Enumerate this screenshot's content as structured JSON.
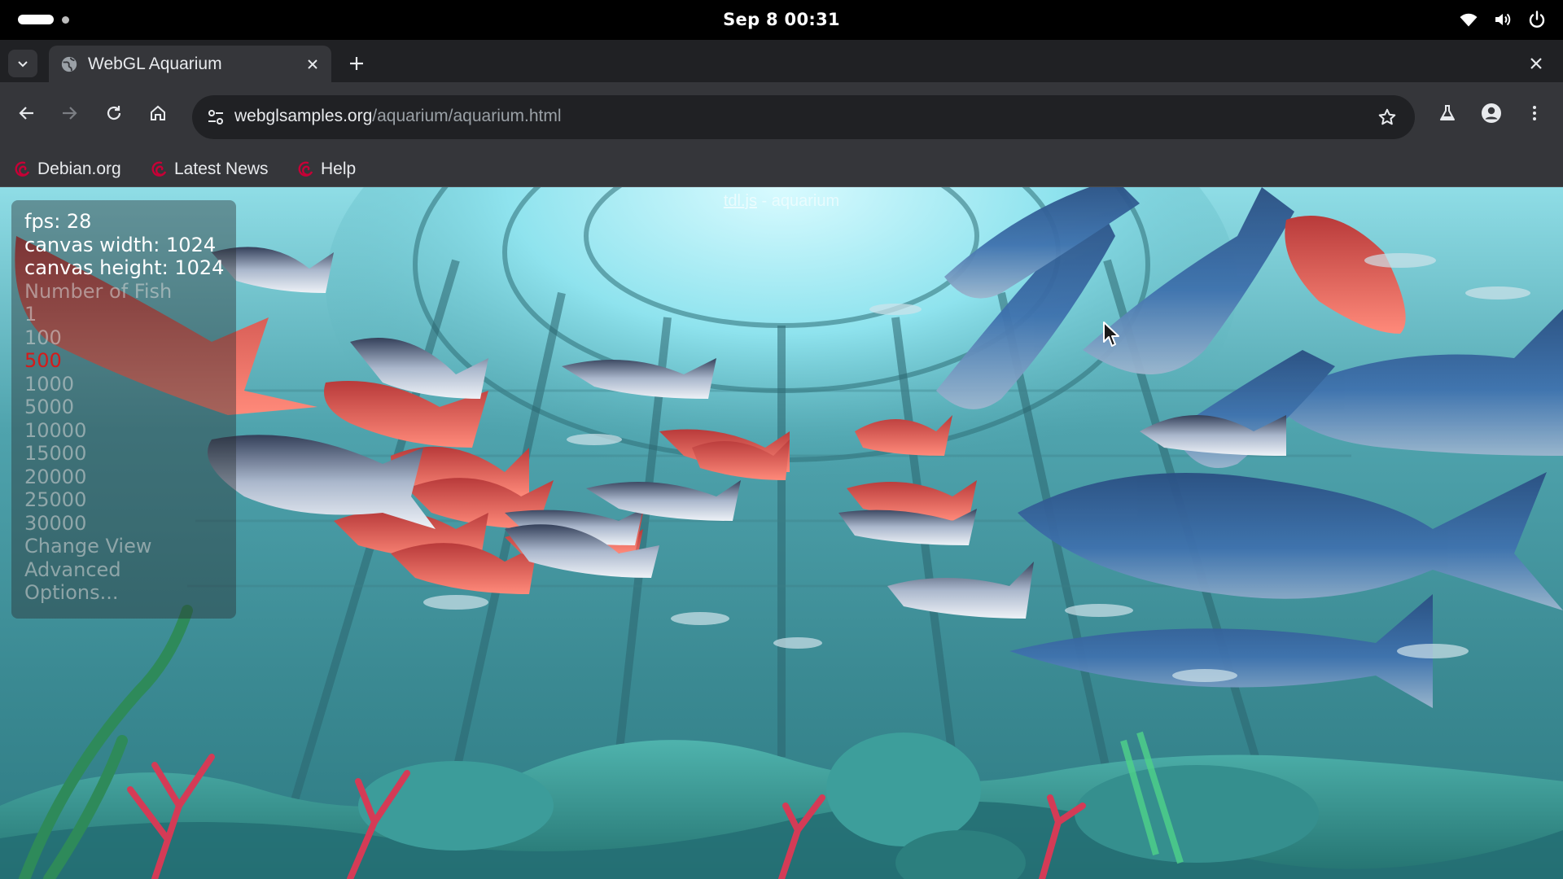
{
  "system_bar": {
    "clock": "Sep 8  00:31",
    "tray_icons": [
      "wifi-icon",
      "volume-icon",
      "power-icon"
    ]
  },
  "browser": {
    "tab": {
      "title": "WebGL Aquarium",
      "favicon": "globe-icon"
    },
    "address": {
      "host": "webglsamples.org",
      "path": "/aquarium/aquarium.html"
    },
    "bookmarks": [
      {
        "label": "Debian.org",
        "icon": "debian-swirl-icon"
      },
      {
        "label": "Latest News",
        "icon": "debian-swirl-icon"
      },
      {
        "label": "Help",
        "icon": "debian-swirl-icon"
      }
    ]
  },
  "aquarium": {
    "heading_link": "tdl.js",
    "heading_rest": " - aquarium",
    "stats": {
      "fps": "fps: 28",
      "canvas_width": "canvas width: 1024",
      "canvas_height": "canvas height: 1024"
    },
    "fish_label": "Number of Fish",
    "fish_options": [
      "1",
      "100",
      "500",
      "1000",
      "5000",
      "10000",
      "15000",
      "20000",
      "25000",
      "30000"
    ],
    "selected_fish": "500",
    "change_view": "Change View",
    "advanced": "Advanced",
    "options": "Options..."
  },
  "colors": {
    "system_bar": "#000000",
    "tab_strip": "#202124",
    "toolbar": "#35363a",
    "omnibox": "#202124",
    "selected_option": "#d61a1a",
    "water_top": "#9fe6ee",
    "water_mid": "#3f8f9a",
    "floor": "#2d7f86"
  }
}
